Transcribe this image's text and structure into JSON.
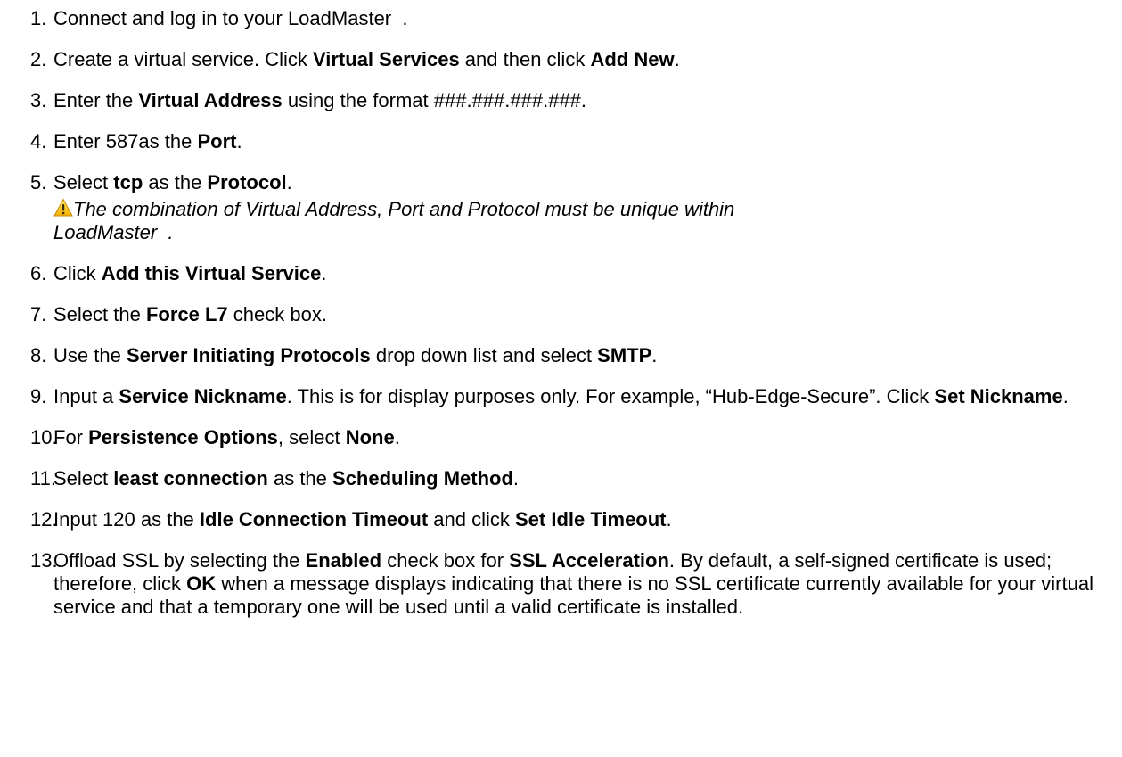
{
  "steps": [
    {
      "number": "1.",
      "parts": [
        {
          "text": "Connect and log in to your LoadMaster  .",
          "bold": false
        }
      ]
    },
    {
      "number": "2.",
      "parts": [
        {
          "text": "Create a virtual service. Click ",
          "bold": false
        },
        {
          "text": "Virtual Services",
          "bold": true
        },
        {
          "text": " and then click ",
          "bold": false
        },
        {
          "text": "Add New",
          "bold": true
        },
        {
          "text": ".",
          "bold": false
        }
      ]
    },
    {
      "number": "3.",
      "parts": [
        {
          "text": "Enter the ",
          "bold": false
        },
        {
          "text": "Virtual Address",
          "bold": true
        },
        {
          "text": " using the format ###.###.###.###.",
          "bold": false
        }
      ]
    },
    {
      "number": "4.",
      "parts": [
        {
          "text": "Enter 587as the ",
          "bold": false
        },
        {
          "text": "Port",
          "bold": true
        },
        {
          "text": ".",
          "bold": false
        }
      ]
    },
    {
      "number": "5.",
      "parts": [
        {
          "text": "Select ",
          "bold": false
        },
        {
          "text": "tcp",
          "bold": true
        },
        {
          "text": " as the ",
          "bold": false
        },
        {
          "text": "Protocol",
          "bold": true
        },
        {
          "text": ".",
          "bold": false
        }
      ],
      "note": {
        "icon": "warning-icon",
        "line1": "The combination of Virtual Address, Port and Protocol must be unique within",
        "line2": "LoadMaster  ."
      }
    },
    {
      "number": "6.",
      "parts": [
        {
          "text": "Click ",
          "bold": false
        },
        {
          "text": "Add this Virtual Service",
          "bold": true
        },
        {
          "text": ".",
          "bold": false
        }
      ]
    },
    {
      "number": "7.",
      "parts": [
        {
          "text": "Select the ",
          "bold": false
        },
        {
          "text": "Force L7",
          "bold": true
        },
        {
          "text": " check box.",
          "bold": false
        }
      ]
    },
    {
      "number": "8.",
      "parts": [
        {
          "text": "Use the ",
          "bold": false
        },
        {
          "text": "Server Initiating Protocols",
          "bold": true
        },
        {
          "text": " drop down list and select ",
          "bold": false
        },
        {
          "text": "SMTP",
          "bold": true
        },
        {
          "text": ".",
          "bold": false
        }
      ]
    },
    {
      "number": "9.",
      "parts": [
        {
          "text": "Input a ",
          "bold": false
        },
        {
          "text": "Service Nickname",
          "bold": true
        },
        {
          "text": ". This is for display purposes only. For example, “Hub-Edge-Secure”. Click ",
          "bold": false
        },
        {
          "text": "Set Nickname",
          "bold": true
        },
        {
          "text": ".",
          "bold": false
        }
      ],
      "wrap": true
    },
    {
      "number": "10.",
      "parts": [
        {
          "text": "For ",
          "bold": false
        },
        {
          "text": "Persistence Options",
          "bold": true
        },
        {
          "text": ", select ",
          "bold": false
        },
        {
          "text": "None",
          "bold": true
        },
        {
          "text": ".",
          "bold": false
        }
      ]
    },
    {
      "number": "11.",
      "parts": [
        {
          "text": "Select ",
          "bold": false
        },
        {
          "text": "least connection",
          "bold": true
        },
        {
          "text": " as the ",
          "bold": false
        },
        {
          "text": "Scheduling Method",
          "bold": true
        },
        {
          "text": ".",
          "bold": false
        }
      ]
    },
    {
      "number": "12.",
      "parts": [
        {
          "text": "Input 120 as the ",
          "bold": false
        },
        {
          "text": "Idle Connection Timeout",
          "bold": true
        },
        {
          "text": " and click ",
          "bold": false
        },
        {
          "text": "Set Idle Timeout",
          "bold": true
        },
        {
          "text": ".",
          "bold": false
        }
      ]
    },
    {
      "number": "13.",
      "parts": [
        {
          "text": "Offload SSL by selecting the ",
          "bold": false
        },
        {
          "text": "Enabled",
          "bold": true
        },
        {
          "text": " check box for ",
          "bold": false
        },
        {
          "text": "SSL Acceleration",
          "bold": true
        },
        {
          "text": ". By default, a self-signed certificate is used; therefore, click ",
          "bold": false
        },
        {
          "text": "OK",
          "bold": true
        },
        {
          "text": " when a message displays indicating that there is no SSL certificate currently available for your virtual service and that a temporary one will be used until a valid certificate is installed.",
          "bold": false
        }
      ],
      "wrap": true
    }
  ]
}
